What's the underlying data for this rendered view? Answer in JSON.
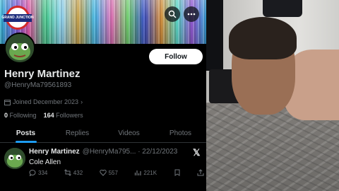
{
  "profile": {
    "banner_badge": "GRAND JUNCTION",
    "follow_label": "Follow",
    "name": "Henry Martinez",
    "handle": "@HenryMa79561893",
    "joined": "Joined December 2023",
    "following_count": "0",
    "following_label": "Following",
    "followers_count": "164",
    "followers_label": "Followers"
  },
  "tabs": [
    {
      "label": "Posts",
      "active": true
    },
    {
      "label": "Replies",
      "active": false
    },
    {
      "label": "Videos",
      "active": false
    },
    {
      "label": "Photos",
      "active": false
    }
  ],
  "tweet": {
    "name": "Henry Martinez",
    "meta": "@HenryMa795... · 22/12/2023",
    "text": "Cole Allen",
    "replies": "334",
    "reposts": "432",
    "likes": "557",
    "views": "221K"
  },
  "colors": {
    "accent": "#1d9bf0",
    "background": "#000000",
    "muted_text": "#71767b"
  },
  "icons": [
    "search-icon",
    "more-icon",
    "calendar-icon",
    "x-logo-icon",
    "reply-icon",
    "repost-icon",
    "like-icon",
    "views-icon",
    "bookmark-icon",
    "share-icon"
  ]
}
